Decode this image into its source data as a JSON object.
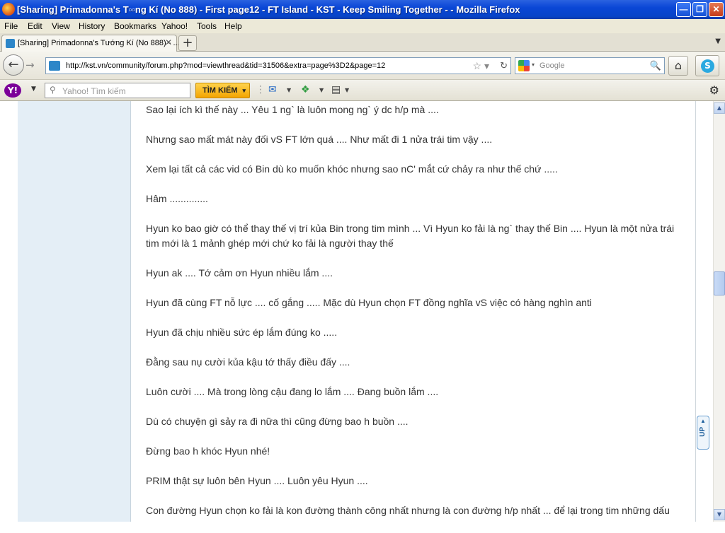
{
  "window": {
    "title": "[Sharing] Primadonna's T▫▫ng Kí (No 888) - First page12 - FT Island - KST - Keep Smiling Together - - Mozilla Firefox",
    "controls": [
      "minimize-icon",
      "restore-icon",
      "close-icon"
    ]
  },
  "menubar": {
    "items": [
      "File",
      "Edit",
      "View",
      "History",
      "Bookmarks",
      "Yahoo!",
      "Tools",
      "Help"
    ]
  },
  "tabs": {
    "active_label": "[Sharing] Primadonna's Tướng Kí (No 888) - ...",
    "new_tab": "+"
  },
  "navigation": {
    "url": "http://kst.vn/community/forum.php?mod=viewthread&tid=31506&extra=page%3D2&page=12",
    "search_placeholder": "Google",
    "icons": [
      "back-arrow-icon",
      "forward-arrow-icon",
      "bookmark-star-icon",
      "reload-icon",
      "magnifier-icon",
      "home-icon",
      "skype-icon"
    ]
  },
  "yahoo_toolbar": {
    "search_placeholder": "Yahoo! Tìm kiếm",
    "search_button": "TÌM KIẾM",
    "icons": [
      "yahoo-logo-icon",
      "mail-icon",
      "plus-widget-icon",
      "clipboard-icon",
      "gear-icon"
    ]
  },
  "post": {
    "lines": [
      "Sao lại ích kì thế này ... Yêu 1 ng` là luôn mong ng` ý dc h/p mà ....",
      "Nhưng sao mất mát này đối vS FT lớn quá .... Như mất đi 1 nửa trái tim vậy ....",
      "Xem lại tất cả các vid có Bin dù ko muốn khóc nhưng sao nC' mắt cứ chảy ra như thế chứ .....",
      "Hâm ..............",
      "Hyun ko bao giờ có thể thay thế vị trí kủa Bin trong tim mình ... Vì Hyun ko fải là ng` thay thế Bin .... Hyun là một nửa trái tim mới là 1 mảnh ghép mới chứ ko fải là người thay thế",
      "Hyun ak .... Tớ cảm ơn Hyun nhiều lắm ....",
      "Hyun đã cùng FT nỗ lực .... cố gắng ..... Mặc dù Hyun chọn FT đồng nghĩa vS việc có hàng nghìn anti",
      "Hyun đã chịu nhiều sức ép lắm đúng ko .....",
      "Đằng sau nụ cười kủa kậu tớ thấy điều đấy ....",
      "Luôn cười .... Mà trong lòng cậu đang lo lắm .... Đang buồn lắm ....",
      "Dù có chuyện gì sảy ra đi nữa thì cũng đừng bao h buồn ....",
      "Đừng bao h khóc Hyun nhé!",
      "PRIM thật sự luôn bên Hyun .... Luôn yêu Hyun ....",
      "Con đường Hyun chọn ko fải là kon đường thành công nhất nhưng là con đường h/p nhất ... để lại trong tim những dấu"
    ]
  },
  "up_button": "UP",
  "scroll": {
    "position": 0.42
  }
}
